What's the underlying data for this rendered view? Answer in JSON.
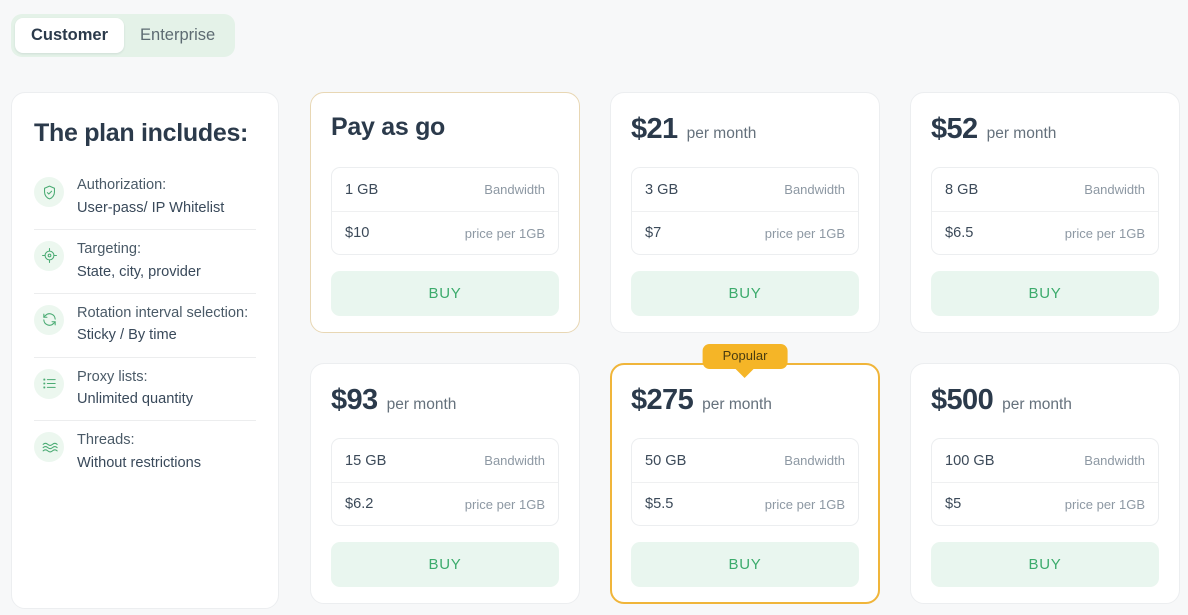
{
  "tabs": [
    {
      "label": "Customer",
      "active": true
    },
    {
      "label": "Enterprise",
      "active": false
    }
  ],
  "sidebar": {
    "title": "The plan includes:",
    "features": [
      {
        "icon": "shield-check-icon",
        "title": "Authorization:",
        "value": "User-pass/ IP Whitelist"
      },
      {
        "icon": "target-icon",
        "title": "Targeting:",
        "value": "State, city, provider"
      },
      {
        "icon": "rotation-icon",
        "title": "Rotation interval selection:",
        "value": "Sticky / By time"
      },
      {
        "icon": "list-icon",
        "title": "Proxy lists:",
        "value": "Unlimited quantity"
      },
      {
        "icon": "threads-icon",
        "title": "Threads:",
        "value": "Without restrictions"
      }
    ]
  },
  "spec_labels": {
    "bandwidth": "Bandwidth",
    "price_per": "price per 1GB"
  },
  "buy_label": "BUY",
  "popular_label": "Popular",
  "colors": {
    "accent_green": "#3cab6c",
    "buy_bg": "#e9f6ef",
    "popular": "#f5b527",
    "tan_border": "#e8d7b4",
    "heading": "#2b3a4b"
  },
  "plans": [
    {
      "price": "Pay as go",
      "period": "",
      "bandwidth": "1 GB",
      "unit_price": "$10",
      "style": "tan",
      "popular": false
    },
    {
      "price": "$21",
      "period": "per month",
      "bandwidth": "3 GB",
      "unit_price": "$7",
      "style": "plain",
      "popular": false
    },
    {
      "price": "$52",
      "period": "per month",
      "bandwidth": "8 GB",
      "unit_price": "$6.5",
      "style": "plain",
      "popular": false
    },
    {
      "price": "$93",
      "period": "per month",
      "bandwidth": "15 GB",
      "unit_price": "$6.2",
      "style": "plain",
      "popular": false
    },
    {
      "price": "$275",
      "period": "per month",
      "bandwidth": "50 GB",
      "unit_price": "$5.5",
      "style": "popular",
      "popular": true
    },
    {
      "price": "$500",
      "period": "per month",
      "bandwidth": "100 GB",
      "unit_price": "$5",
      "style": "plain",
      "popular": false
    }
  ]
}
